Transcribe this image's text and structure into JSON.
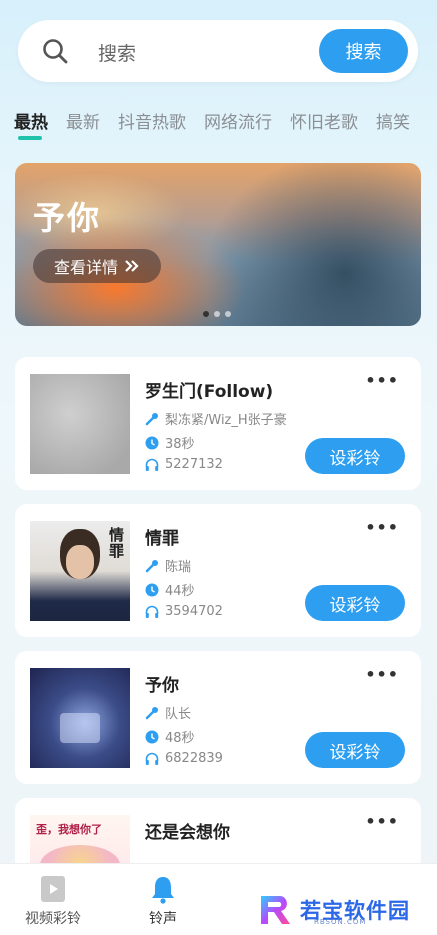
{
  "search": {
    "placeholder": "搜索",
    "button_label": "搜索"
  },
  "tabs": [
    "最热",
    "最新",
    "抖音热歌",
    "网络流行",
    "怀旧老歌",
    "搞笑"
  ],
  "banner": {
    "title": "予你",
    "button_label": "查看详情"
  },
  "songs": [
    {
      "title": "罗生门(Follow)",
      "artist": "梨冻紧/Wiz_H张子豪",
      "duration": "38秒",
      "plays": "5227132",
      "button": "设彩铃"
    },
    {
      "title": "情罪",
      "artist": "陈瑞",
      "duration": "44秒",
      "plays": "3594702",
      "button": "设彩铃"
    },
    {
      "title": "予你",
      "artist": "队长",
      "duration": "48秒",
      "plays": "6822839",
      "button": "设彩铃"
    },
    {
      "title": "还是会想你",
      "cover_text": "歪，我想你了"
    }
  ],
  "more_label": "•••",
  "nav": {
    "video": "视频彩铃",
    "ringtone": "铃声"
  },
  "watermark": {
    "text": "若宝软件园",
    "sub": "RBSON.COM"
  },
  "colors": {
    "accent": "#2e9ff0",
    "tab_indicator": "#1fc3a9"
  }
}
